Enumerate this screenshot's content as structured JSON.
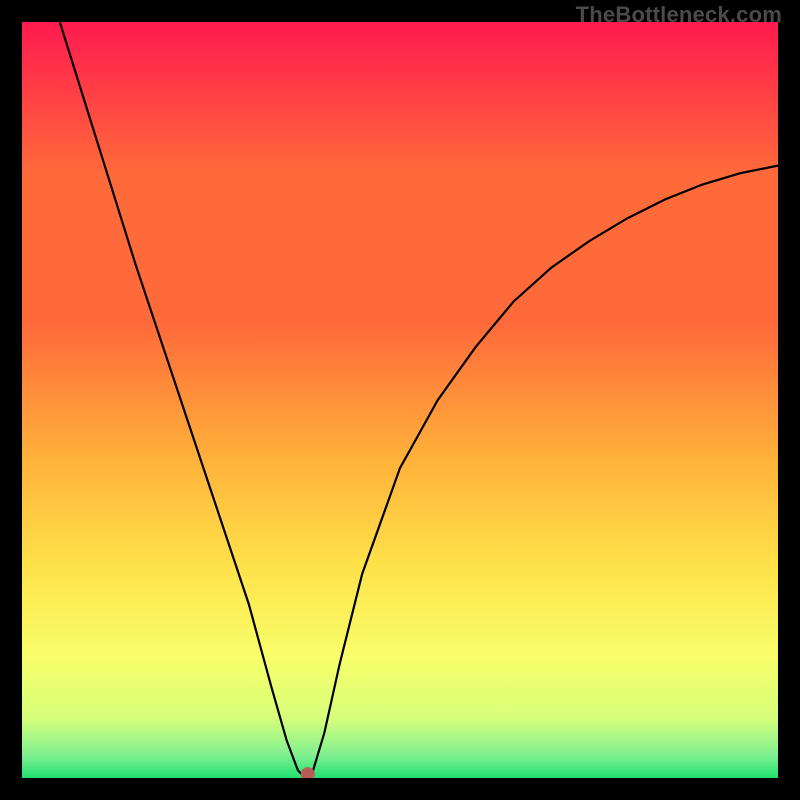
{
  "watermark": "TheBottleneck.com",
  "chart_data": {
    "type": "line",
    "title": "",
    "xlabel": "",
    "ylabel": "",
    "xlim": [
      0,
      100
    ],
    "ylim": [
      0,
      100
    ],
    "grid": false,
    "background_gradient": {
      "top_color": "#ff1a4f",
      "mid_colors": [
        "#ff6a3a",
        "#ffb23a",
        "#ffe24a",
        "#f8ff6a",
        "#d7ff7a"
      ],
      "bottom_color": "#20e070"
    },
    "curve": {
      "name": "bottleneck-curve",
      "color": "#000000",
      "x": [
        5,
        10,
        15,
        20,
        25,
        30,
        33,
        35,
        36.5,
        37.5,
        38.5,
        40,
        42,
        45,
        50,
        55,
        60,
        65,
        70,
        75,
        80,
        85,
        90,
        95,
        100
      ],
      "y": [
        100,
        84,
        68,
        53,
        38,
        23,
        12,
        5,
        1,
        0,
        1,
        6,
        15,
        27,
        41,
        50,
        57,
        63,
        67.5,
        71,
        74,
        76.5,
        78.5,
        80,
        81
      ]
    },
    "marker": {
      "name": "minimum-point",
      "x": 37.8,
      "y": 0.5,
      "color": "#b85a55",
      "radius_px": 7
    }
  }
}
